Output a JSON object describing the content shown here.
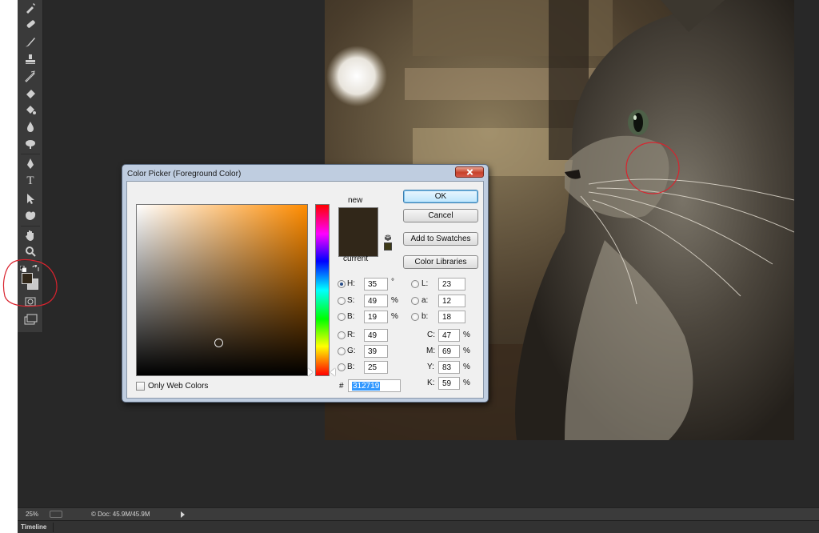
{
  "workspace": {
    "background": "#282828"
  },
  "toolbar": {
    "tools": [
      {
        "name": "eyedropper-tool-icon"
      },
      {
        "name": "healing-brush-tool-icon"
      },
      {
        "name": "brush-tool-icon"
      },
      {
        "name": "clone-stamp-tool-icon"
      },
      {
        "name": "history-brush-tool-icon"
      },
      {
        "name": "eraser-tool-icon"
      },
      {
        "name": "paint-bucket-tool-icon"
      },
      {
        "name": "blur-tool-icon"
      },
      {
        "name": "dodge-tool-icon"
      },
      {
        "name": "pen-tool-icon"
      },
      {
        "name": "type-tool-icon",
        "glyph": "T"
      },
      {
        "name": "path-selection-tool-icon"
      },
      {
        "name": "custom-shape-tool-icon"
      },
      {
        "name": "hand-tool-icon"
      },
      {
        "name": "zoom-tool-icon"
      }
    ],
    "foreground_color": "#312719",
    "background_color": "#c9c9c9"
  },
  "dialog": {
    "title": "Color Picker (Foreground Color)",
    "new_label": "new",
    "current_label": "current",
    "new_color": "#312719",
    "current_color": "#312719",
    "buttons": {
      "ok": "OK",
      "cancel": "Cancel",
      "add_to_swatches": "Add to Swatches",
      "color_libraries": "Color Libraries"
    },
    "only_web_colors": "Only Web Colors",
    "hsb": {
      "h_label": "H:",
      "h_value": "35",
      "h_unit": "°",
      "s_label": "S:",
      "s_value": "49",
      "s_unit": "%",
      "b_label": "B:",
      "b_value": "19",
      "b_unit": "%"
    },
    "rgb": {
      "r_label": "R:",
      "r_value": "49",
      "g_label": "G:",
      "g_value": "39",
      "b_label": "B:",
      "b_value": "25"
    },
    "lab": {
      "l_label": "L:",
      "l_value": "23",
      "a_label": "a:",
      "a_value": "12",
      "b_label": "b:",
      "b_value": "18"
    },
    "cmyk": {
      "c_label": "C:",
      "c_value": "47",
      "c_unit": "%",
      "m_label": "M:",
      "m_value": "69",
      "m_unit": "%",
      "y_label": "Y:",
      "y_value": "83",
      "y_unit": "%",
      "k_label": "K:",
      "k_value": "59",
      "k_unit": "%"
    },
    "hex_label": "#",
    "hex_value": "312719",
    "selected_mode": "H"
  },
  "status": {
    "zoom": "25%",
    "doc_info": "© Doc: 45.9M/45.9M",
    "timeline_tab": "Timeline"
  },
  "annotations": {
    "circle_color": "#d9232e"
  }
}
